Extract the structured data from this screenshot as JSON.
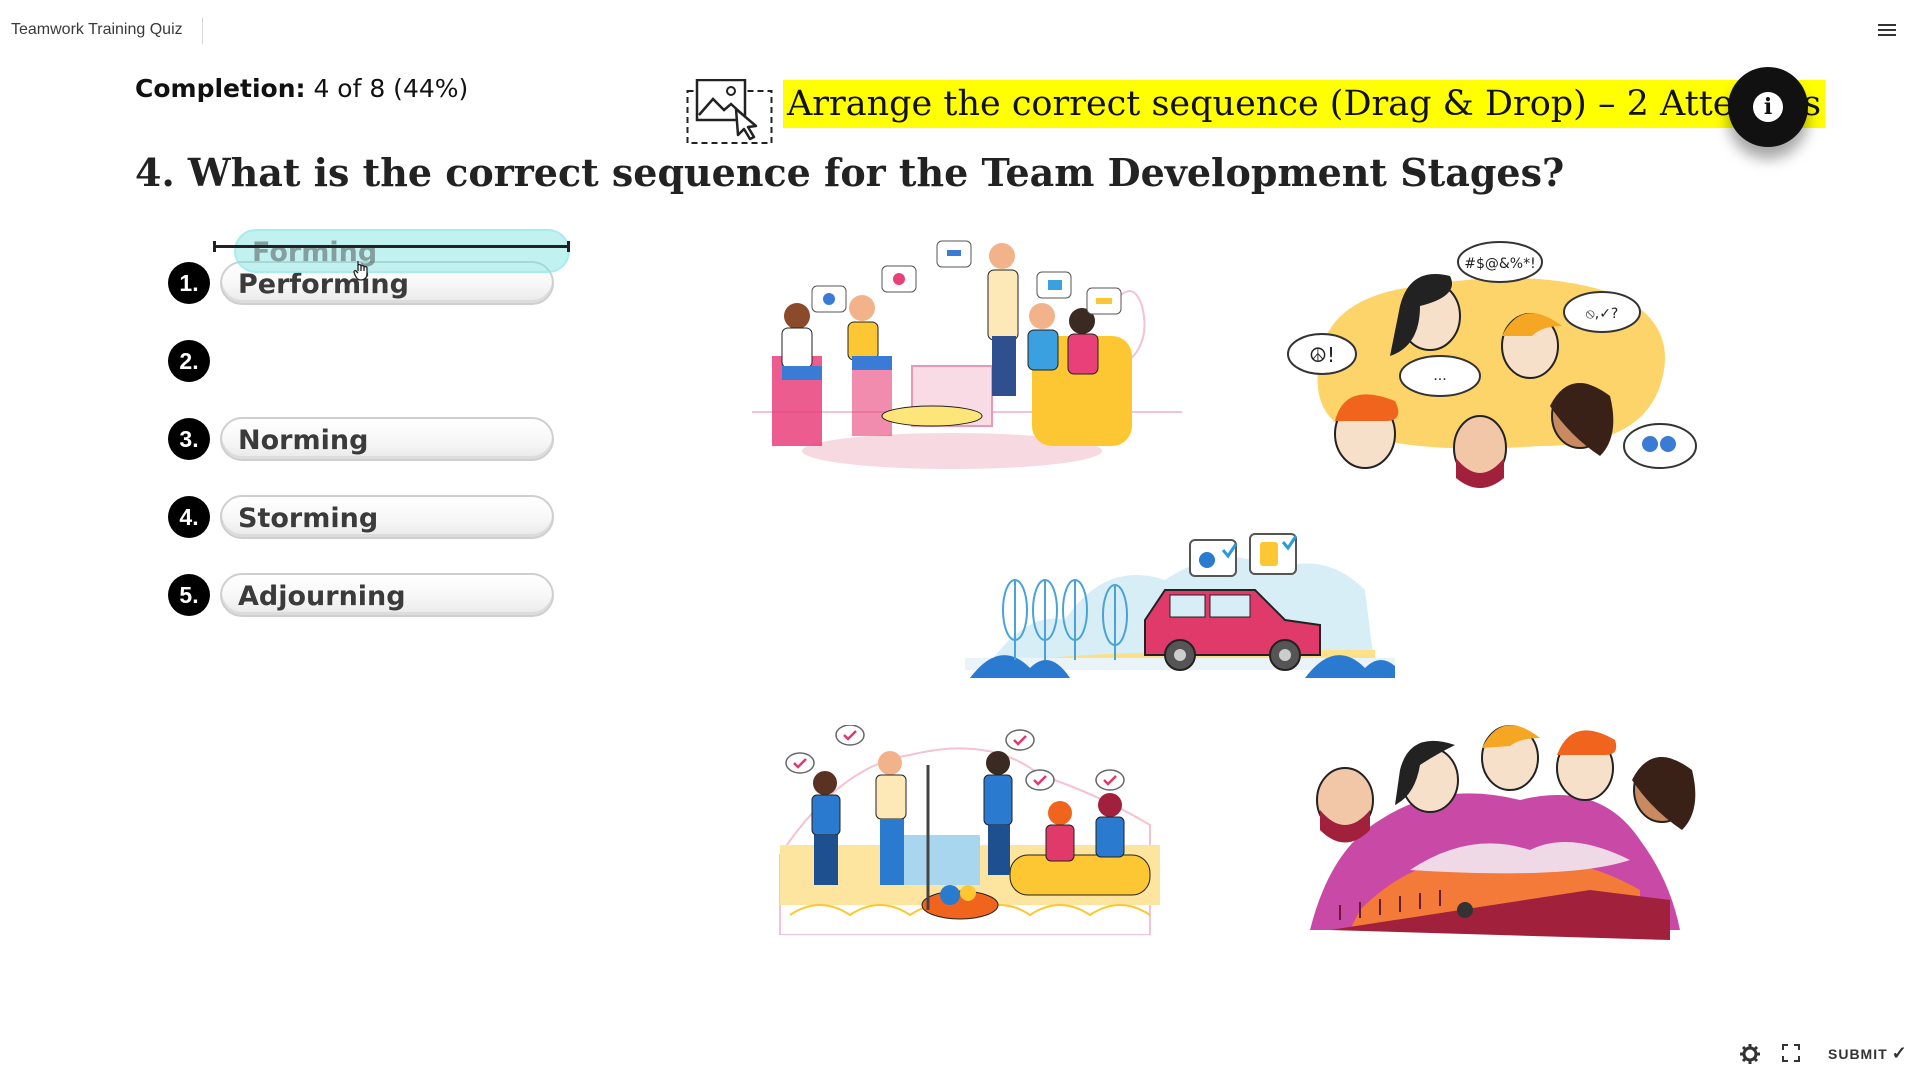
{
  "app": {
    "title": "Teamwork Training Quiz"
  },
  "progress": {
    "label": "Completion:",
    "value": "4 of 8 (44%)",
    "fraction": 0.44
  },
  "instruction": {
    "text": "Arrange the correct sequence (Drag & Drop) – 2 Attempts",
    "highlight_color": "#ffff00",
    "icon": "drag-drop-image-icon"
  },
  "info_button": {
    "icon": "info-icon",
    "glyph": "i"
  },
  "question": {
    "text": "4. What is the correct sequence for the Team Development Stages?"
  },
  "slots": [
    {
      "number": "1.",
      "answer": "Performing"
    },
    {
      "number": "2.",
      "answer": ""
    },
    {
      "number": "3.",
      "answer": "Norming"
    },
    {
      "number": "4.",
      "answer": "Storming"
    },
    {
      "number": "5.",
      "answer": "Adjourning"
    }
  ],
  "dragging": {
    "label": "Forming",
    "highlight_color": "#78e1e1"
  },
  "illustrations": [
    {
      "name": "team-meeting-illustration"
    },
    {
      "name": "arguing-faces-illustration"
    },
    {
      "name": "car-journey-illustration"
    },
    {
      "name": "team-success-illustration"
    },
    {
      "name": "sad-faces-farewell-illustration"
    }
  ],
  "bottom_bar": {
    "settings_icon": "gear-icon",
    "fullscreen_icon": "fullscreen-icon",
    "submit_label": "SUBMIT",
    "submit_check": "✓"
  }
}
